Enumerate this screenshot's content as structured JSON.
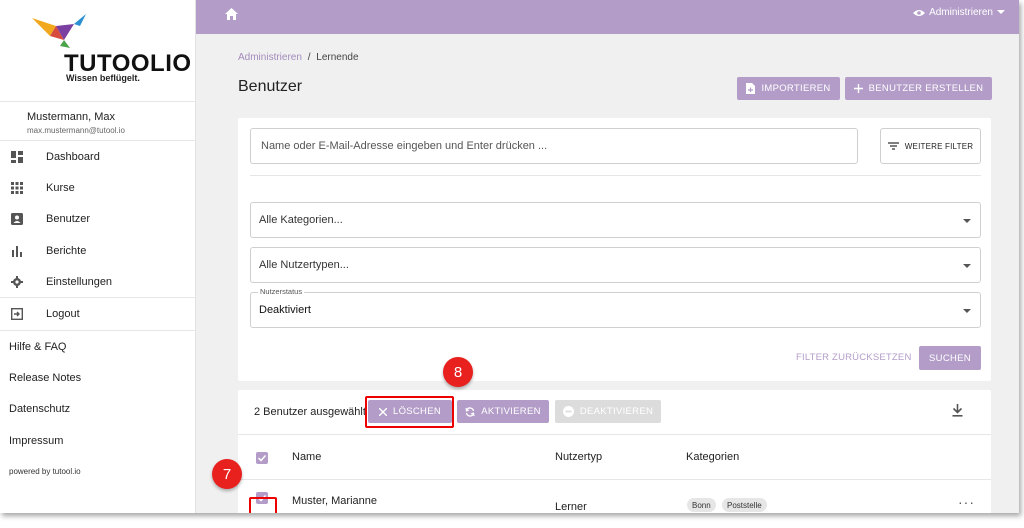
{
  "brand": {
    "name": "TUTOOLIO",
    "tagline": "Wissen beflügelt."
  },
  "user": {
    "name": "Mustermann, Max",
    "email": "max.mustermann@tutool.io"
  },
  "nav": {
    "items": [
      {
        "label": "Dashboard",
        "icon": "dashboard-icon"
      },
      {
        "label": "Kurse",
        "icon": "grid-icon"
      },
      {
        "label": "Benutzer",
        "icon": "person-icon"
      },
      {
        "label": "Berichte",
        "icon": "bar-chart-icon"
      },
      {
        "label": "Einstellungen",
        "icon": "gear-icon"
      },
      {
        "label": "Logout",
        "icon": "logout-icon"
      }
    ],
    "extra": [
      "Hilfe & FAQ",
      "Release Notes",
      "Datenschutz",
      "Impressum"
    ],
    "powered": "powered by tutool.io"
  },
  "topbar": {
    "mode_label": "Administrieren"
  },
  "breadcrumb": {
    "parent": "Administrieren",
    "separator": "/",
    "current": "Lernende"
  },
  "page": {
    "title": "Benutzer"
  },
  "actions": {
    "import_label": "IMPORTIEREN",
    "create_label": "BENUTZER ERSTELLEN"
  },
  "filters": {
    "search_placeholder": "Name oder E-Mail-Adresse eingeben und Enter drücken ...",
    "more_label": "WEITERE FILTER",
    "category": "Alle Kategorien...",
    "user_type": "Alle Nutzertypen...",
    "status_legend": "Nutzerstatus",
    "status": "Deaktiviert",
    "reset_label": "FILTER ZURÜCKSETZEN",
    "search_label": "SUCHEN"
  },
  "bulk": {
    "selected_text": "2 Benutzer ausgewählt",
    "delete_label": "LÖSCHEN",
    "activate_label": "AKTIVIEREN",
    "deactivate_label": "DEAKTIVIEREN"
  },
  "table": {
    "headers": {
      "name": "Name",
      "type": "Nutzertyp",
      "categories": "Kategorien"
    },
    "rows": [
      {
        "name": "Muster, Marianne",
        "type": "Lerner",
        "categories": [
          "Bonn",
          "Poststelle"
        ],
        "more": "···"
      }
    ]
  },
  "markers": {
    "delete_step": "8",
    "row_step": "7"
  },
  "colors": {
    "accent": "#b39dc8",
    "marker": "#e8201e",
    "highlight": "#e00000"
  }
}
